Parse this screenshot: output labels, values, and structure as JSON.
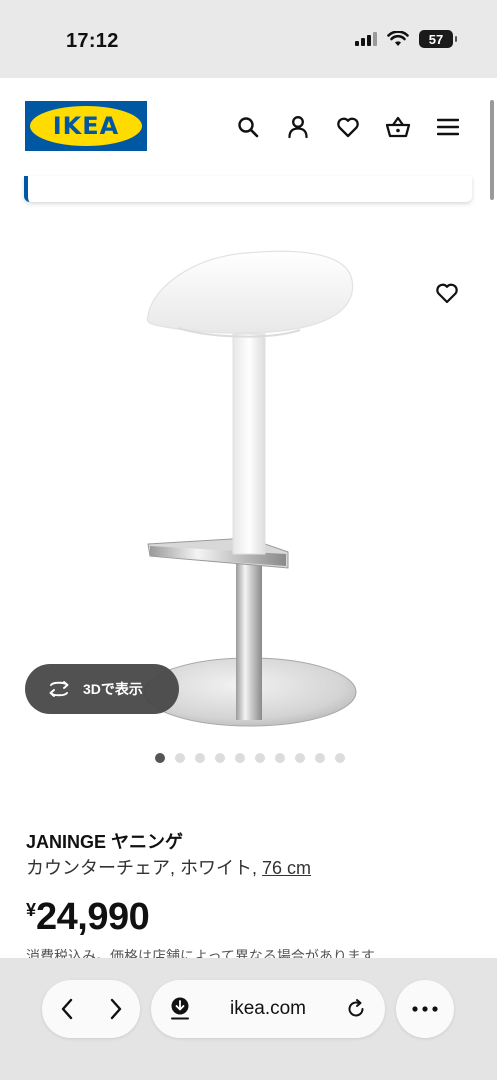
{
  "status_bar": {
    "time": "17:12",
    "battery": "57"
  },
  "header": {
    "logo_text": "IKEA",
    "icons": [
      "search-icon",
      "account-icon",
      "favorites-icon",
      "cart-icon",
      "menu-icon"
    ]
  },
  "product": {
    "name": "JANINGE ヤニンゲ",
    "description": "カウンターチェア, ホワイト,",
    "size_link": "76 cm",
    "currency": "¥",
    "price": "24,990",
    "tax_note": "消費税込み。価格は店舗によって異なる場合があります",
    "view_3d_label": "3Dで表示",
    "image_count": 10,
    "active_image_index": 0
  },
  "browser": {
    "url": "ikea.com"
  },
  "colors": {
    "ikea_blue": "#0058a3",
    "ikea_yellow": "#ffdb00"
  }
}
